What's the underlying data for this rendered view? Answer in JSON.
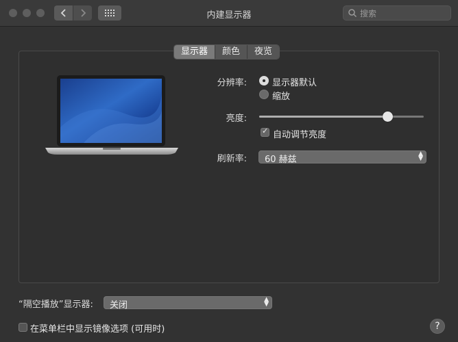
{
  "window": {
    "title": "内建显示器"
  },
  "search": {
    "placeholder": "搜索"
  },
  "tabs": [
    {
      "label": "显示器",
      "active": true
    },
    {
      "label": "颜色",
      "active": false
    },
    {
      "label": "夜览",
      "active": false
    }
  ],
  "resolution": {
    "label": "分辨率:",
    "options": [
      {
        "label": "显示器默认",
        "selected": true
      },
      {
        "label": "缩放",
        "selected": false
      }
    ]
  },
  "brightness": {
    "label": "亮度:",
    "level": 0.8,
    "auto_label": "自动调节亮度",
    "auto_checked": true
  },
  "refresh": {
    "label": "刷新率:",
    "value": "60 赫兹"
  },
  "airplay": {
    "label": "“隔空播放”显示器:",
    "value": "关闭"
  },
  "mirror_option": {
    "label": "在菜单栏中显示镜像选项 (可用时)",
    "checked": false
  },
  "help": {
    "label": "?"
  },
  "colors": {
    "background": "#323232",
    "panel": "#2f2f2f",
    "accent": "#dcdcdc"
  }
}
